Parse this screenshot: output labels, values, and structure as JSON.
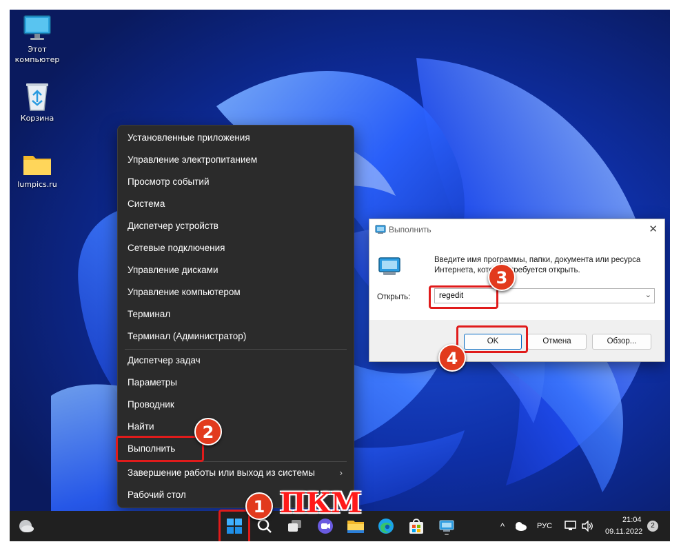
{
  "desktop": {
    "icons": [
      {
        "label": "Этот\nкомпьютер",
        "icon": "monitor-icon"
      },
      {
        "label": "Корзина",
        "icon": "recycle-bin-icon"
      },
      {
        "label": "lumpics.ru",
        "icon": "folder-icon"
      }
    ]
  },
  "context_menu": {
    "items": [
      {
        "label": "Установленные приложения"
      },
      {
        "label": "Управление электропитанием"
      },
      {
        "label": "Просмотр событий"
      },
      {
        "label": "Система"
      },
      {
        "label": "Диспетчер устройств"
      },
      {
        "label": "Сетевые подключения"
      },
      {
        "label": "Управление дисками"
      },
      {
        "label": "Управление компьютером"
      },
      {
        "label": "Терминал"
      },
      {
        "label": "Терминал (Администратор)"
      },
      {
        "label": "Диспетчер задач"
      },
      {
        "label": "Параметры"
      },
      {
        "label": "Проводник"
      },
      {
        "label": "Найти"
      },
      {
        "label": "Выполнить"
      },
      {
        "label": "Завершение работы или выход из системы",
        "submenu_arrow": "›"
      },
      {
        "label": "Рабочий стол"
      }
    ]
  },
  "run_dialog": {
    "title": "Выполнить",
    "close_glyph": "✕",
    "description": "Введите имя программы, папки, документа или ресурса Интернета, которые требуется открыть.",
    "open_label": "Открыть:",
    "input_value": "regedit",
    "dropdown_glyph": "⌄",
    "ok_label": "OK",
    "cancel_label": "Отмена",
    "browse_label": "Обзор..."
  },
  "taskbar": {
    "tray": {
      "chevron": "^",
      "language": "РУС",
      "time": "21:04",
      "date": "09.11.2022",
      "notifications_count": "2"
    },
    "apps": [
      "start-icon",
      "search-icon",
      "task-view-icon",
      "chat-icon",
      "file-explorer-icon",
      "edge-icon",
      "store-icon",
      "run-app-icon"
    ]
  },
  "annotations": {
    "badges": [
      "1",
      "2",
      "3",
      "4"
    ],
    "caption": "ПКМ",
    "highlight_color": "#e01b1b"
  },
  "colors": {
    "menu_bg": "#2b2b2b",
    "taskbar_bg": "#202020",
    "accent_blue": "#0067c0"
  }
}
